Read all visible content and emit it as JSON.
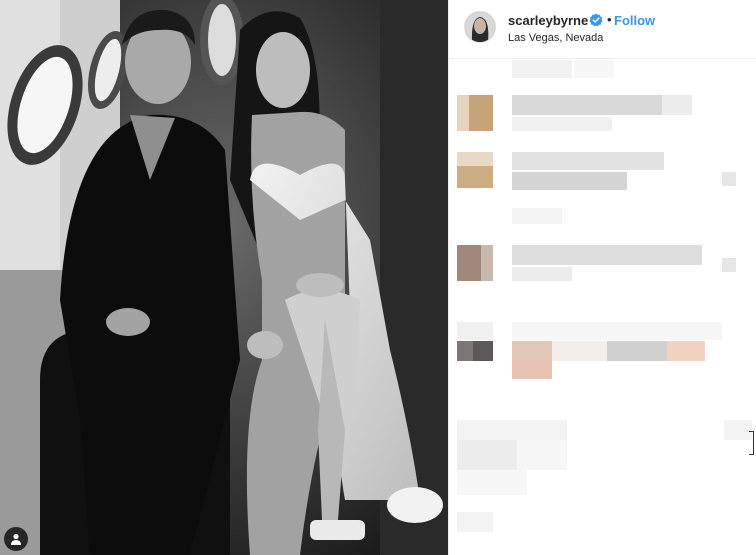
{
  "post": {
    "username": "scarleybyrne",
    "follow_label": "Follow",
    "separator": "•",
    "location": "Las Vegas, Nevada",
    "verified": true
  },
  "icons": {
    "verified": "verified-badge-icon",
    "user_tag": "user-tag-icon"
  },
  "colors": {
    "link": "#3897f0",
    "verified": "#3897f0",
    "text": "#262626",
    "divider": "#efefef"
  }
}
